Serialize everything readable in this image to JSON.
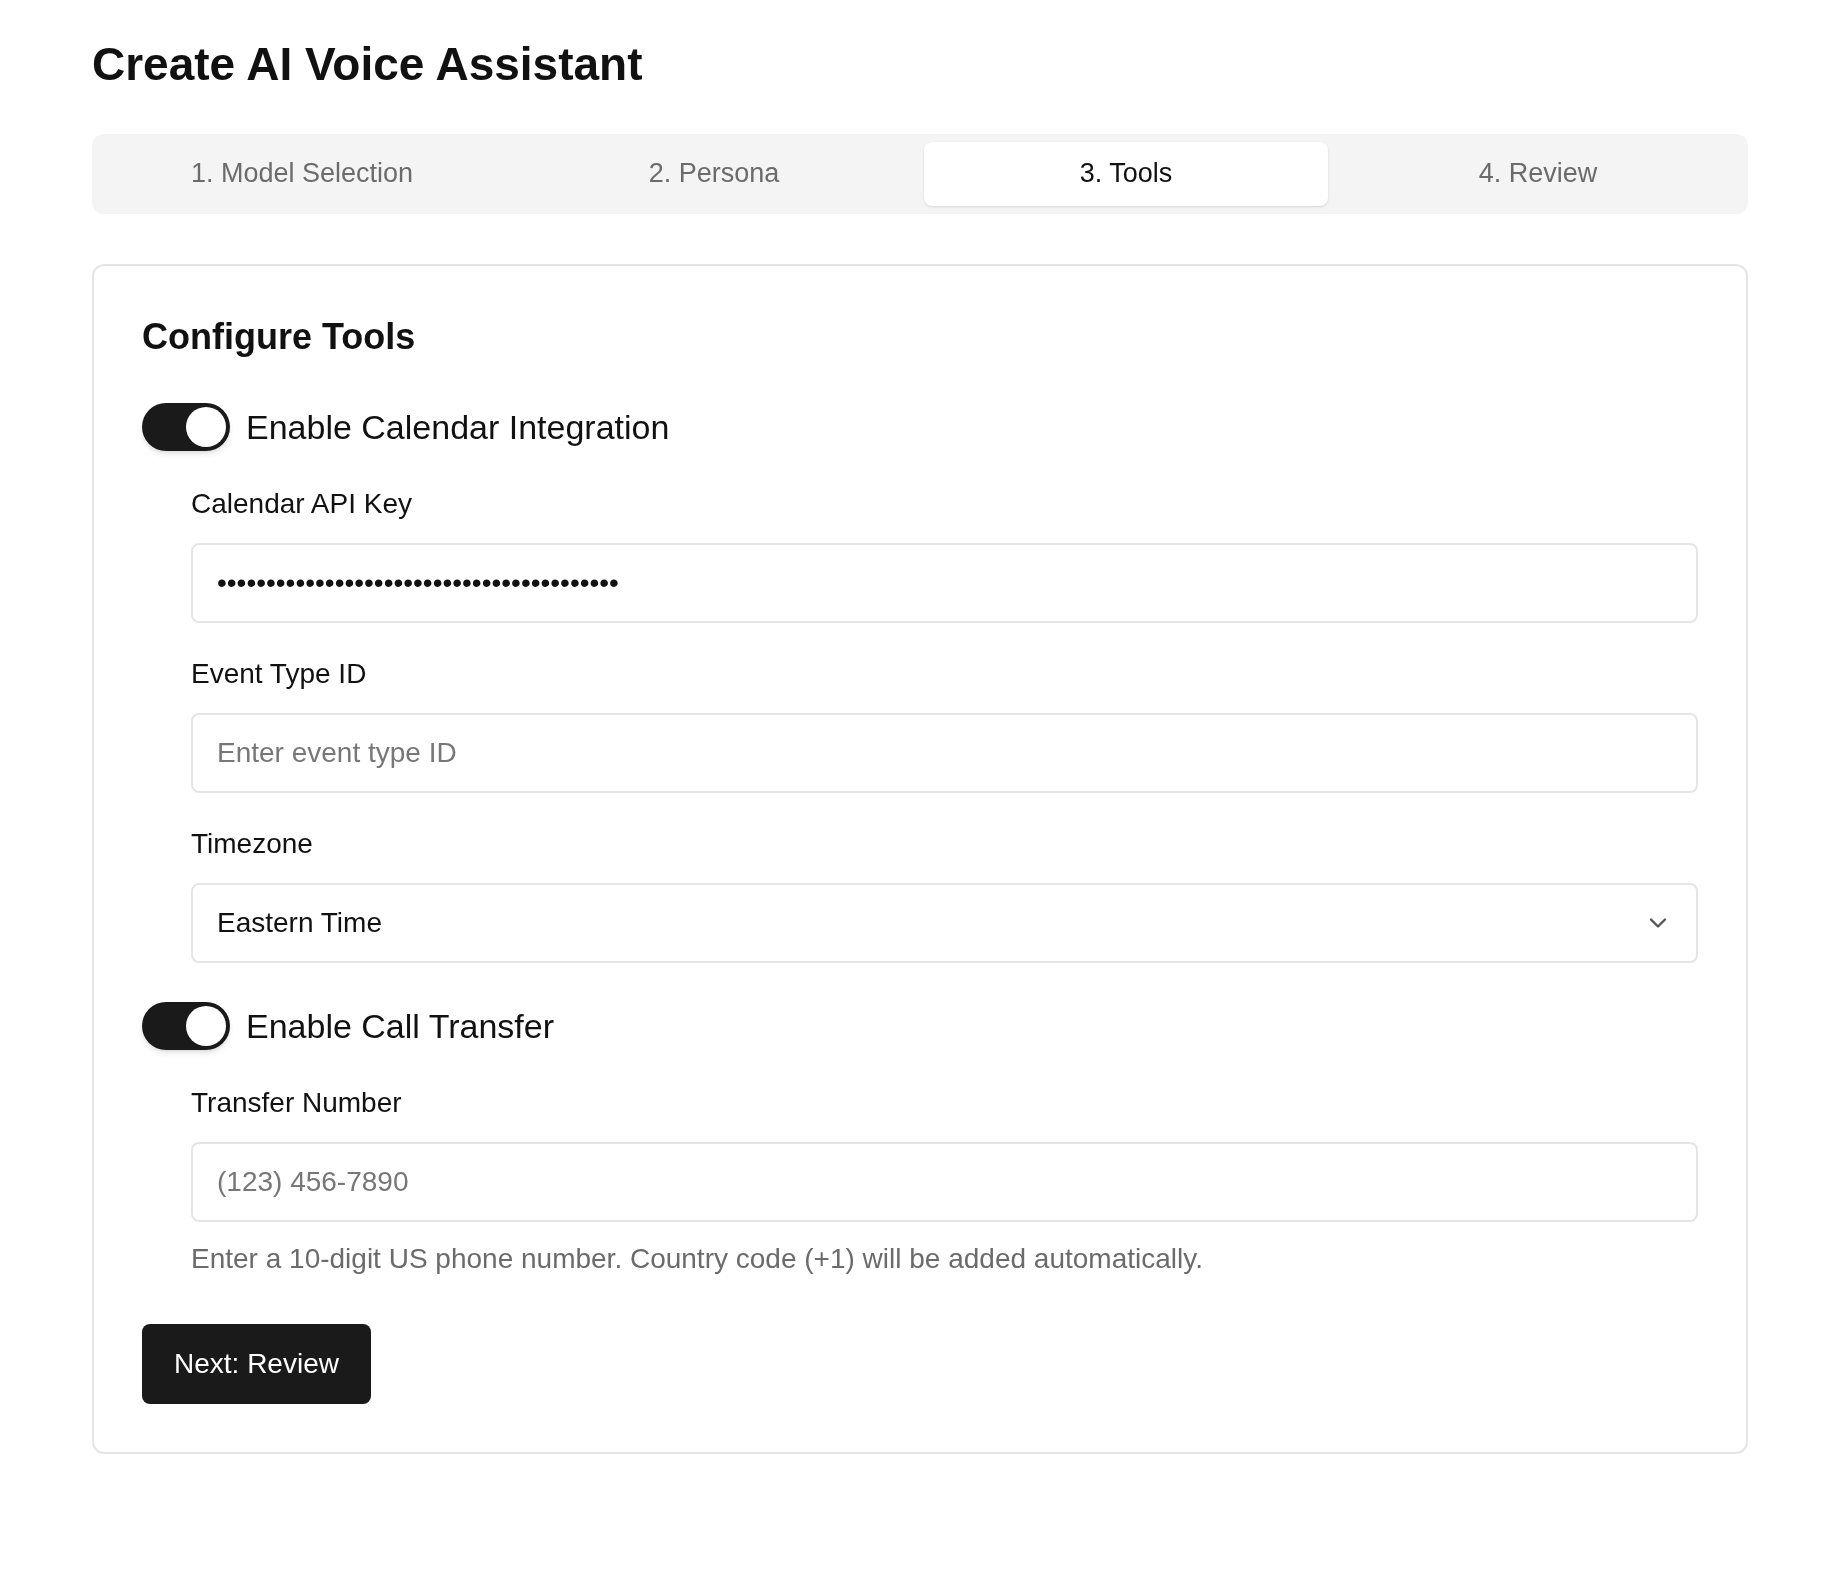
{
  "title": "Create AI Voice Assistant",
  "tabs": [
    {
      "label": "1. Model Selection",
      "selected": false
    },
    {
      "label": "2. Persona",
      "selected": false
    },
    {
      "label": "3. Tools",
      "selected": true
    },
    {
      "label": "4. Review",
      "selected": false
    }
  ],
  "card": {
    "heading": "Configure Tools",
    "sections": [
      {
        "label": "Enable Calendar Integration",
        "on": true,
        "fields": [
          {
            "kind": "input",
            "label": "Calendar API Key",
            "value": "•••••••••••••••••••••••••••••••••••••••••"
          },
          {
            "kind": "input",
            "label": "Event Type ID",
            "placeholder": "Enter event type ID"
          },
          {
            "kind": "select",
            "label": "Timezone",
            "value": "Eastern Time"
          }
        ]
      },
      {
        "label": "Enable Call Transfer",
        "on": true,
        "fields": [
          {
            "kind": "input",
            "label": "Transfer Number",
            "placeholder": "(123) 456-7890",
            "hint": "Enter a 10-digit US phone number. Country code (+1) will be added automatically."
          }
        ]
      }
    ],
    "button": "Next: Review"
  }
}
